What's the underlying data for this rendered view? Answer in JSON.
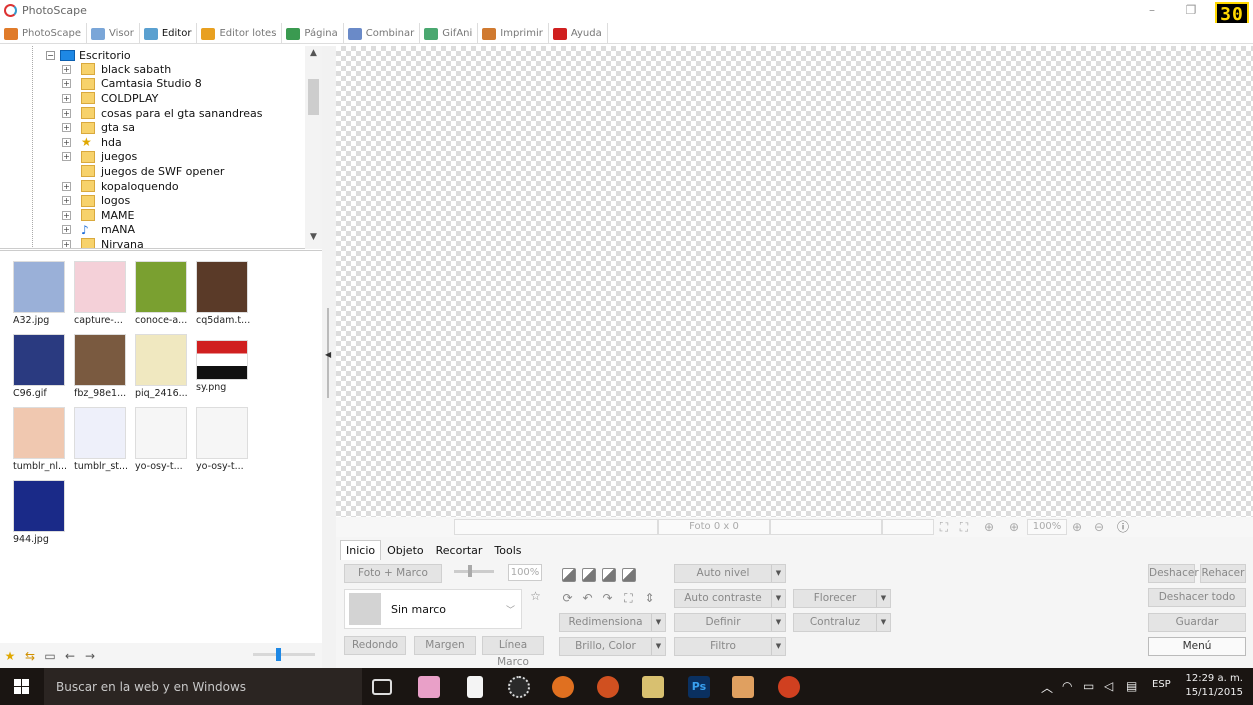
{
  "window": {
    "title": "PhotoScape",
    "badge": "30"
  },
  "tabs": [
    {
      "label": "PhotoScape",
      "color": "#e07b2a"
    },
    {
      "label": "Visor",
      "color": "#7aa6d8"
    },
    {
      "label": "Editor",
      "color": "#5aa0d0"
    },
    {
      "label": "Editor lotes",
      "color": "#e8a020"
    },
    {
      "label": "Página",
      "color": "#3a9a50"
    },
    {
      "label": "Combinar",
      "color": "#6a8ac8"
    },
    {
      "label": "GifAni",
      "color": "#4aa870"
    },
    {
      "label": "Imprimir",
      "color": "#d07a30"
    },
    {
      "label": "Ayuda",
      "color": "#d02020"
    }
  ],
  "tree": {
    "root": "Escritorio",
    "items": [
      {
        "label": "black sabath",
        "expand": true,
        "icon": "folder"
      },
      {
        "label": "Camtasia Studio 8",
        "expand": true,
        "icon": "folder"
      },
      {
        "label": "COLDPLAY",
        "expand": true,
        "icon": "folder"
      },
      {
        "label": "cosas para el gta sanandreas",
        "expand": true,
        "icon": "folder"
      },
      {
        "label": "gta sa",
        "expand": true,
        "icon": "folder"
      },
      {
        "label": "hda",
        "expand": true,
        "icon": "star"
      },
      {
        "label": "juegos",
        "expand": true,
        "icon": "folder"
      },
      {
        "label": "juegos de SWF opener",
        "expand": false,
        "icon": "folder"
      },
      {
        "label": "kopaloquendo",
        "expand": true,
        "icon": "folder"
      },
      {
        "label": "logos",
        "expand": true,
        "icon": "folder"
      },
      {
        "label": "MAME",
        "expand": true,
        "icon": "folder"
      },
      {
        "label": "mANA",
        "expand": true,
        "icon": "note"
      },
      {
        "label": "Nirvana",
        "expand": true,
        "icon": "folder"
      }
    ]
  },
  "thumbnails": [
    {
      "caption": "A32.jpg",
      "bg": "#9ab0d8"
    },
    {
      "caption": "capture-...",
      "bg": "#f4d0d8"
    },
    {
      "caption": "conoce-a...",
      "bg": "#7aa030"
    },
    {
      "caption": "cq5dam.t...",
      "bg": "#5a3a28"
    },
    {
      "caption": "C96.gif",
      "bg": "#2a3a80"
    },
    {
      "caption": "fbz_98e1...",
      "bg": "#7a5a40"
    },
    {
      "caption": "piq_2416...",
      "bg": "#f0e8c0"
    },
    {
      "caption": "sy.png",
      "bg": "#d02020"
    },
    {
      "caption": "tumblr_nl...",
      "bg": "#f0c8b0"
    },
    {
      "caption": "tumblr_st...",
      "bg": "#eef0fa"
    },
    {
      "caption": "yo-osy-t...",
      "bg": "#f6f6f6"
    },
    {
      "caption": "yo-osy-t...",
      "bg": "#f6f6f6"
    },
    {
      "caption": "944.jpg",
      "bg": "#1a2a88"
    }
  ],
  "status": {
    "photo_size": "Foto 0 x 0",
    "zoom": "100%"
  },
  "subtabs": [
    "Inicio",
    "Objeto",
    "Recortar",
    "Tools"
  ],
  "frame": {
    "photo_frame_btn": "Foto + Marco",
    "percent": "100%",
    "frame_name": "Sin marco",
    "rounded": "Redondo",
    "margin": "Margen",
    "frame_line": "Línea Marco"
  },
  "adjust": {
    "resize": "Redimensiona",
    "brightness": "Brillo, Color",
    "auto_level": "Auto nivel",
    "auto_contrast": "Auto contraste",
    "sharpen": "Definir",
    "filter": "Filtro",
    "bloom": "Florecer",
    "backlight": "Contraluz"
  },
  "actions": {
    "undo": "Deshacer",
    "redo": "Rehacer",
    "undo_all": "Deshacer todo",
    "save": "Guardar",
    "menu": "Menú"
  },
  "taskbar": {
    "search_placeholder": "Buscar en la web y en Windows",
    "lang": "ESP",
    "time": "12:29 a. m.",
    "date": "15/11/2015"
  }
}
